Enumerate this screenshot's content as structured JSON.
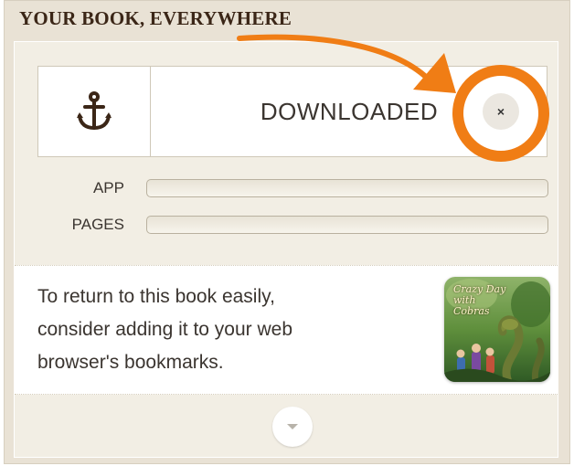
{
  "panel": {
    "title": "YOUR BOOK, EVERYWHERE"
  },
  "download": {
    "status_label": "DOWNLOADED",
    "close_glyph": "×",
    "icon": "anchor-icon"
  },
  "progress": [
    {
      "label": "APP",
      "value": 0
    },
    {
      "label": "PAGES",
      "value": 0
    }
  ],
  "info": {
    "lines": [
      "To return to this book easily,",
      "consider adding it to your web",
      "browser's bookmarks."
    ],
    "thumbnail_title": "Crazy Day with Cobras"
  },
  "expand": {
    "icon": "chevron-down-icon"
  },
  "annotation": {
    "color": "#f07d15"
  }
}
